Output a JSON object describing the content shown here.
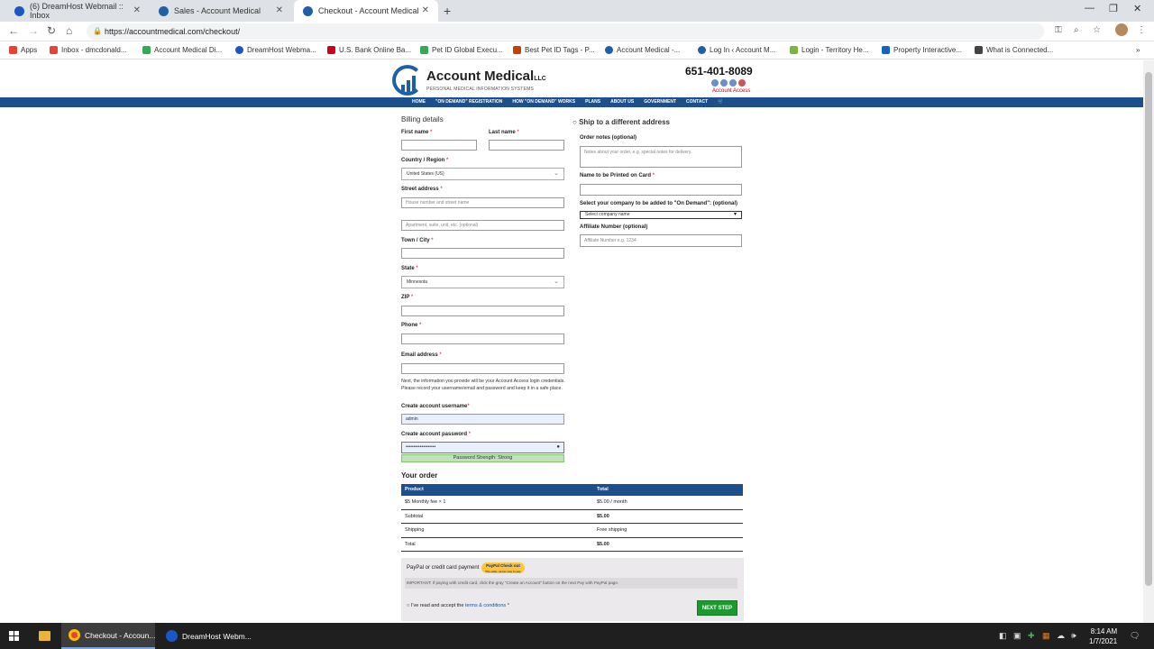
{
  "browser": {
    "tabs": [
      {
        "title": "(6) DreamHost Webmail :: Inbox",
        "icon_color": "#1a56c4"
      },
      {
        "title": "Sales - Account Medical",
        "icon_color": "#1f5fa8"
      },
      {
        "title": "Checkout - Account Medical",
        "icon_color": "#1f5fa8",
        "active": true
      }
    ],
    "new_tab_symbol": "+",
    "url": "https://accountmedical.com/checkout/",
    "bookmarks": [
      {
        "label": "Apps",
        "color": "#e94235"
      },
      {
        "label": "Inbox - dmcdonald...",
        "color": "#ea4335"
      },
      {
        "label": "Account Medical Di...",
        "color": "#34a853"
      },
      {
        "label": "DreamHost Webma...",
        "color": "#1a56c4"
      },
      {
        "label": "U.S. Bank Online Ba...",
        "color": "#d0021b"
      },
      {
        "label": "Pet ID Global Execu...",
        "color": "#34a853"
      },
      {
        "label": "Best Pet ID Tags - P...",
        "color": "#c2410c"
      },
      {
        "label": "Account Medical -...",
        "color": "#1f5fa8"
      },
      {
        "label": "Log In ‹ Account M...",
        "color": "#1f5fa8"
      },
      {
        "label": "Login - Territory He...",
        "color": "#7cb342"
      },
      {
        "label": "Property Interactive...",
        "color": "#1565c0"
      },
      {
        "label": "What is Connected...",
        "color": "#444444"
      }
    ]
  },
  "site": {
    "logo_name": "Account Medical",
    "logo_suffix": "LLC",
    "logo_tagline": "PERSONAL MEDICAL INFORMATION SYSTEMS",
    "phone": "651-401-8089",
    "account_access": "Account Access",
    "nav": [
      "HOME",
      "\"ON DEMAND\" REGISTRATION",
      "HOW \"ON DEMAND\" WORKS",
      "PLANS",
      "ABOUT US",
      "GOVERNMENT",
      "CONTACT",
      "🛒"
    ]
  },
  "billing": {
    "title": "Billing details",
    "first_name_label": "First name",
    "last_name_label": "Last name",
    "country_label": "Country / Region",
    "country_value": "United States (US)",
    "street_label": "Street address",
    "street_placeholder": "House number and street name",
    "apt_placeholder": "Apartment, suite, unit, etc. (optional)",
    "city_label": "Town / City",
    "state_label": "State",
    "state_value": "Minnesota",
    "zip_label": "ZIP",
    "phone_label": "Phone",
    "email_label": "Email address",
    "note": "Next, the information you provide will be your Account Access login credentials. Please record your username/email and password and keep it in a safe place.",
    "username_label": "Create account username",
    "username_value": "admin",
    "password_label": "Create account password",
    "password_value": "•••••••••••••••••••",
    "strength": "Password Strength: Strong",
    "required_mark": "*"
  },
  "shipping": {
    "ship_label": "Ship to a different address",
    "notes_label": "Order notes (optional)",
    "notes_placeholder": "Notes about your order, e.g. special notes for delivery.",
    "card_name_label": "Name to be Printed on Card",
    "company_label": "Select your company to be added to \"On Demand\": (optional)",
    "company_value": "Select company name",
    "affiliate_label": "Affiliate Number (optional)",
    "affiliate_placeholder": "Affiliate Number e.g. 1234"
  },
  "order": {
    "title": "Your order",
    "headers": [
      "Product",
      "Total"
    ],
    "rows": [
      {
        "label": "$5 Monthly fee  × 1",
        "value": "$5.00 / month",
        "bold_value": false
      },
      {
        "label": "Subtotal",
        "value": "$5.00",
        "bold_value": true
      },
      {
        "label": "Shipping",
        "value": "Free shipping",
        "bold_value": false
      },
      {
        "label": "Total",
        "value": "$5.00",
        "bold_value": true
      }
    ]
  },
  "payment": {
    "method_label": "PayPal or credit card payment",
    "badge_text": "PayPal Check out",
    "badge_subtext": "The safer, easier way to pay",
    "important": "IMPORTANT: If paying with credit card, click the gray \"Create an Account\" button on the next Pay with PayPal page.",
    "terms_prefix": "I've read and accept the",
    "terms_link": "terms & conditions",
    "terms_required": "*",
    "next_label": "NEXT STEP"
  },
  "taskbar": {
    "apps": [
      {
        "label": "Checkout - Accoun...",
        "icon_color": "#e94235",
        "active": true
      },
      {
        "label": "DreamHost Webm...",
        "icon_color": "#1a56c4",
        "active": false
      }
    ],
    "time": "8:14 AM",
    "date": "1/7/2021"
  }
}
